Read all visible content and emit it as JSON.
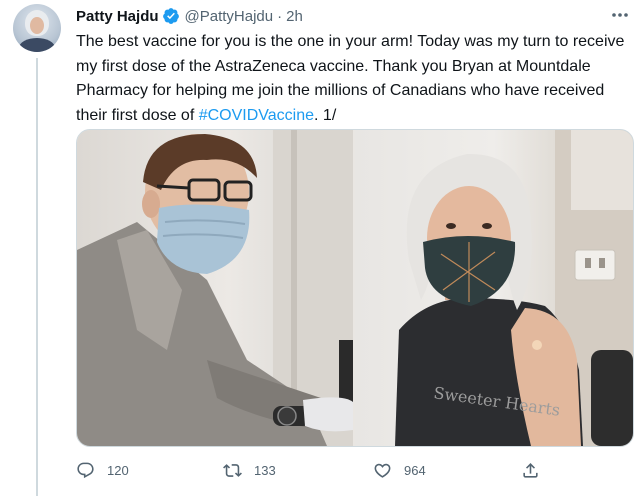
{
  "tweet": {
    "author_name": "Patty Hajdu",
    "handle": "@PattyHajdu",
    "separator": "·",
    "timestamp": "2h",
    "text_before": "The best vaccine for you is the one in your arm! Today was my turn to receive my first dose of the AstraZeneca vaccine. Thank you Bryan at Mountdale Pharmacy for helping me join the millions of Canadians who have received their first dose of ",
    "hashtag": "#COVIDVaccine",
    "text_after": ". 1/",
    "shirt_print": "Sweeter Hearts",
    "icons": {
      "avatar": "profile-avatar",
      "verified": "verified-badge-icon",
      "more": "more-options-icon",
      "reply": "reply-icon",
      "retweet": "retweet-icon",
      "like": "heart-icon",
      "share": "share-icon"
    }
  },
  "actions": {
    "reply_count": "120",
    "retweet_count": "133",
    "like_count": "964"
  },
  "colors": {
    "accent": "#1d9bf0",
    "text": "#0f1419",
    "secondary": "#536471",
    "border": "#cfd9de"
  }
}
